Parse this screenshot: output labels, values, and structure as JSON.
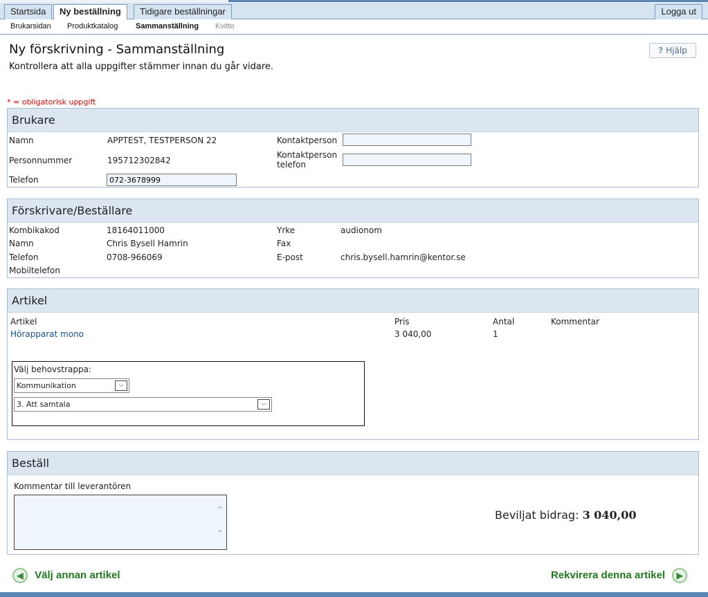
{
  "tabs": {
    "startsida": "Startsida",
    "ny_bestallning": "Ny beställning",
    "tidigare": "Tidigare beställningar",
    "logout": "Logga ut"
  },
  "subnav": {
    "brukarsidan": "Brukarsidan",
    "produktkatalog": "Produktkatalog",
    "sammanstallning": "Sammanställning",
    "kvitto": "Kvitto"
  },
  "page": {
    "title": "Ny förskrivning - Sammanställning",
    "subtitle": "Kontrollera att alla uppgifter stämmer innan du går vidare.",
    "help": "Hjälp",
    "help_icon": "?",
    "required_note": "* = obligatorisk uppgift"
  },
  "brukare": {
    "heading": "Brukare",
    "namn_label": "Namn",
    "namn": "APPTEST, TESTPERSON 22",
    "pnr_label": "Personnummer",
    "pnr": "195712302842",
    "telefon_label": "Telefon",
    "telefon": "072-3678999",
    "kontakt_label": "Kontaktperson",
    "kontakt_value": "",
    "kontakt_tel_label_1": "Kontaktperson",
    "kontakt_tel_label_2": "telefon",
    "kontakt_tel_value": ""
  },
  "forskrivare": {
    "heading": "Förskrivare/Beställare",
    "kombikod_label": "Kombikakod",
    "kombikod": "18164011000",
    "namn_label": "Namn",
    "namn": "Chris Bysell Hamrin",
    "telefon_label": "Telefon",
    "telefon": "0708-966069",
    "mobil_label": "Mobiltelefon",
    "yrke_label": "Yrke",
    "yrke": "audionom",
    "fax_label": "Fax",
    "epost_label": "E-post",
    "epost": "chris.bysell.hamrin@kentor.se"
  },
  "artikel": {
    "heading": "Artikel",
    "col_artikel": "Artikel",
    "col_pris": "Pris",
    "col_antal": "Antal",
    "col_kommentar": "Kommentar",
    "row_name": "Hörapparat mono",
    "row_pris": "3 040,00",
    "row_antal": "1",
    "behov_label": "Välj behovstrappa:",
    "select1": "Kommunikation",
    "select2": "3. Att samtala"
  },
  "bestall": {
    "heading": "Beställ",
    "comment_label": "Kommentar till leverantören",
    "bidrag_label": "Beviljat bidrag:",
    "bidrag_value": "3 040,00"
  },
  "footer": {
    "back": "Välj annan artikel",
    "forward": "Rekvirera denna artikel"
  },
  "colors": {
    "accent_blue": "#5b86b3",
    "panel_head": "#dbe6f1",
    "nav_green": "#1f7a1f",
    "required_red": "#d40000"
  }
}
